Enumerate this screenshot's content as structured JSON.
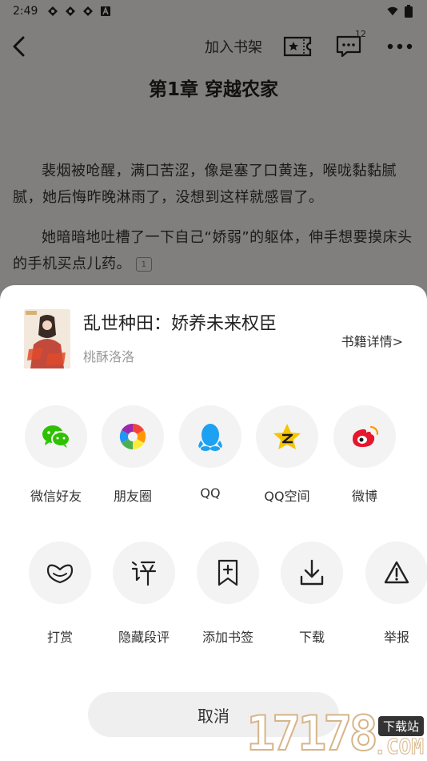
{
  "status": {
    "time": "2:49",
    "icons": [
      "notif-icon",
      "notif-icon",
      "notif-icon",
      "a-icon"
    ],
    "right_icons": [
      "wifi-icon",
      "battery-icon"
    ]
  },
  "topbar": {
    "add_to_shelf": "加入书架",
    "comment_count": "12"
  },
  "reader": {
    "chapter_title": "第1章 穿越农家",
    "para1": "裴烟被呛醒，满口苦涩，像是塞了口黄连，喉咙黏黏腻腻，她后悔昨晚淋雨了，没想到这样就感冒了。",
    "para2": "她暗暗地吐槽了一下自己“娇弱”的躯体，伸手想要摸床头的手机买点儿药。",
    "para2_badge": "1"
  },
  "sheet": {
    "book_title": "乱世种田：娇养未来权臣",
    "book_author": "桃酥洛洛",
    "book_detail": "书籍详情>",
    "share_items": [
      {
        "label": "微信好友",
        "icon": "wechat-icon"
      },
      {
        "label": "朋友圈",
        "icon": "moments-icon"
      },
      {
        "label": "QQ",
        "icon": "qq-icon"
      },
      {
        "label": "QQ空间",
        "icon": "qzone-icon"
      },
      {
        "label": "微博",
        "icon": "weibo-icon"
      }
    ],
    "action_items": [
      {
        "label": "打赏",
        "icon": "reward-icon"
      },
      {
        "label": "隐藏段评",
        "icon": "hide-comment-icon"
      },
      {
        "label": "添加书签",
        "icon": "bookmark-icon"
      },
      {
        "label": "下载",
        "icon": "download-icon"
      },
      {
        "label": "举报",
        "icon": "report-icon"
      }
    ],
    "cancel": "取消"
  },
  "watermark": {
    "number": "17178",
    "badge": "下载站",
    "com": ".COM"
  },
  "colors": {
    "wechat": "#2dc100",
    "qq": "#1da1f2",
    "qzone": "#f5c400",
    "weibo": "#e6162d",
    "dim": "rgba(0,0,0,0.48)"
  }
}
